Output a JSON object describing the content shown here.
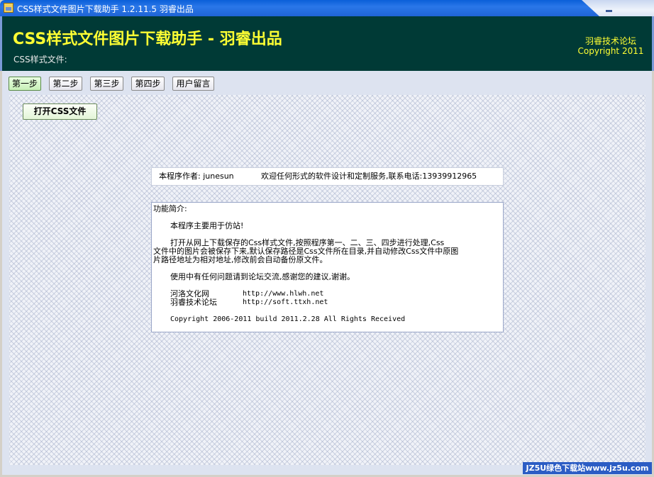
{
  "window": {
    "title": "CSS样式文件图片下载助手 1.2.11.5  羽睿出品",
    "minimize_icon": "minimize-icon",
    "app_icon": "app-icon"
  },
  "header": {
    "main_title": "CSS样式文件图片下载助手 - 羽睿出品",
    "css_file_label": "CSS样式文件:",
    "forum_name": "羽睿技术论坛",
    "copyright": "Copyright 2011"
  },
  "tabs": [
    {
      "label": "第一步",
      "active": true
    },
    {
      "label": "第二步",
      "active": false
    },
    {
      "label": "第三步",
      "active": false
    },
    {
      "label": "第四步",
      "active": false
    },
    {
      "label": "用户留言",
      "active": false
    }
  ],
  "open_button": {
    "label": "打开CSS文件"
  },
  "author_info": {
    "author": "本程序作者: junesun",
    "service": "欢迎任何形式的软件设计和定制服务,联系电话:13939912965"
  },
  "intro": {
    "heading": "功能简介:",
    "purpose": "本程序主要用于仿站!",
    "desc1": "打开从网上下载保存的Css样式文件,按照程序第一、二、三、四步进行处理,Css",
    "desc2": "文件中的图片会被保存下来,默认保存路径是Css文件所在目录,并自动修改Css文件中原图",
    "desc3": "片路径地址为相对地址,修改前会自动备份原文件。",
    "feedback": "使用中有任何问题请到论坛交流,感谢您的建议,谢谢。",
    "site1_name": "河洛文化网",
    "site1_url": "http://www.hlwh.net",
    "site2_name": "羽睿技术论坛",
    "site2_url": "http://soft.ttxh.net",
    "copyright": "Copyright 2006-2011  build 2011.2.28  All Rights Received"
  },
  "watermark": "JZ5U绿色下载站www.jz5u.com"
}
